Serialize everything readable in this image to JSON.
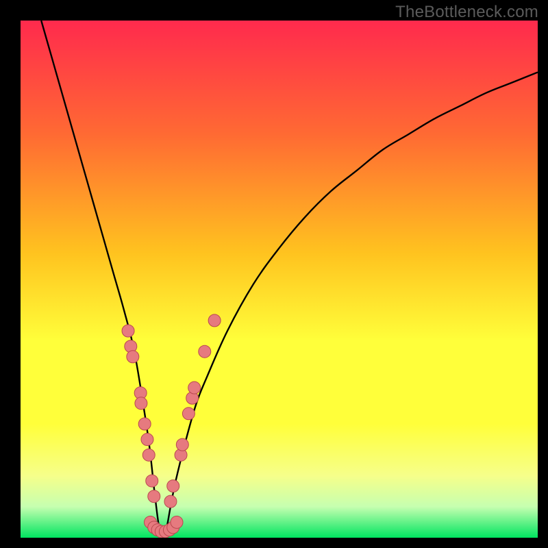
{
  "watermark": "TheBottleneck.com",
  "colors": {
    "bg_black": "#000000",
    "grad_top": "#ff2a4d",
    "grad_mid1": "#ff6a33",
    "grad_mid2": "#ffc31f",
    "grad_mid3": "#ffff3a",
    "grad_low1": "#f6ff8a",
    "grad_low2": "#c6ffb0",
    "grad_bottom": "#00e560",
    "curve": "#000000",
    "dot_fill": "#e67a7f",
    "dot_stroke": "#b9494f"
  },
  "chart_data": {
    "type": "line",
    "title": "",
    "xlabel": "",
    "ylabel": "",
    "xlim": [
      0,
      100
    ],
    "ylim": [
      0,
      100
    ],
    "notes": "V-shaped bottleneck curve with minimum near x≈27. Pink scatter dots cluster around the trough region. Background is a vertical red→green gradient. No axis ticks or labels are visible.",
    "series": [
      {
        "name": "bottleneck-curve",
        "x": [
          4,
          6,
          8,
          10,
          12,
          14,
          16,
          18,
          20,
          22,
          24,
          25,
          26,
          27,
          28,
          29,
          30,
          32,
          34,
          36,
          40,
          45,
          50,
          55,
          60,
          65,
          70,
          75,
          80,
          85,
          90,
          95,
          100
        ],
        "y": [
          100,
          93,
          86,
          79,
          72,
          65,
          58,
          51,
          44,
          36,
          24,
          17,
          8,
          1,
          1,
          6,
          11,
          19,
          26,
          31,
          40,
          49,
          56,
          62,
          67,
          71,
          75,
          78,
          81,
          83.5,
          86,
          88,
          90
        ]
      }
    ],
    "scatter": [
      {
        "name": "sample-dots",
        "points": [
          {
            "x": 20.8,
            "y": 40
          },
          {
            "x": 21.3,
            "y": 37
          },
          {
            "x": 21.7,
            "y": 35
          },
          {
            "x": 23.2,
            "y": 28
          },
          {
            "x": 23.3,
            "y": 26
          },
          {
            "x": 24.0,
            "y": 22
          },
          {
            "x": 24.5,
            "y": 19
          },
          {
            "x": 24.8,
            "y": 16
          },
          {
            "x": 25.4,
            "y": 11
          },
          {
            "x": 25.8,
            "y": 8
          },
          {
            "x": 25.1,
            "y": 3
          },
          {
            "x": 25.8,
            "y": 2
          },
          {
            "x": 26.5,
            "y": 1.5
          },
          {
            "x": 27.2,
            "y": 1.2
          },
          {
            "x": 28.0,
            "y": 1.2
          },
          {
            "x": 28.8,
            "y": 1.5
          },
          {
            "x": 29.5,
            "y": 2
          },
          {
            "x": 30.2,
            "y": 3
          },
          {
            "x": 29.0,
            "y": 7
          },
          {
            "x": 29.5,
            "y": 10
          },
          {
            "x": 31.0,
            "y": 16
          },
          {
            "x": 31.3,
            "y": 18
          },
          {
            "x": 32.5,
            "y": 24
          },
          {
            "x": 33.2,
            "y": 27
          },
          {
            "x": 33.6,
            "y": 29
          },
          {
            "x": 35.6,
            "y": 36
          },
          {
            "x": 37.5,
            "y": 42
          }
        ]
      }
    ]
  }
}
